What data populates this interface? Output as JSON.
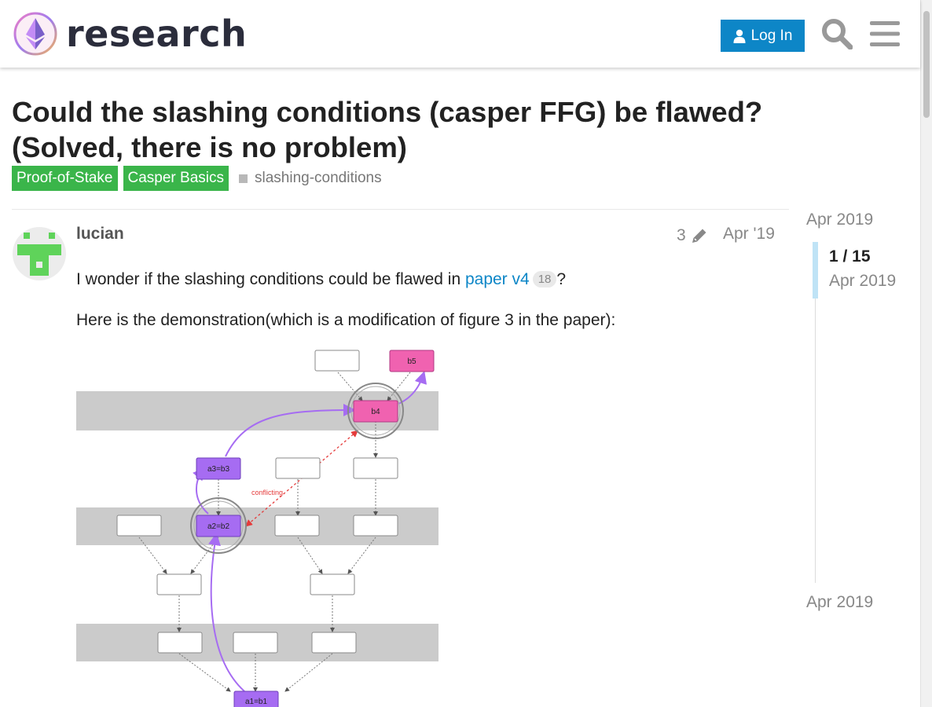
{
  "header": {
    "site_name": "research",
    "login_label": "Log In"
  },
  "topic": {
    "title": "Could the slashing conditions (casper FFG) be flawed? (Solved, there is no problem)",
    "categories": [
      "Proof-of-Stake",
      "Casper Basics"
    ],
    "tag": "slashing-conditions"
  },
  "post": {
    "username": "lucian",
    "edit_count": "3",
    "date": "Apr '19",
    "p1_before": "I wonder if the slashing conditions could be flawed in ",
    "p1_link": "paper v4",
    "p1_clicks": "18",
    "p1_after": "?",
    "p2": "Here is the demonstration(which is a modification of figure 3 in the paper):",
    "figure": {
      "labels": {
        "b5": "b5",
        "b4": "b4",
        "a3b3": "a3=b3",
        "a2b2": "a2=b2",
        "a1b1": "a1=b1",
        "conflicting": "conflicting"
      }
    }
  },
  "timeline": {
    "start": "Apr 2019",
    "position": "1 / 15",
    "position_date": "Apr 2019",
    "end": "Apr 2019"
  },
  "colors": {
    "brand_blue": "#0d86c7",
    "category_green": "#3ab54a",
    "highlight_pink": "#f062b0",
    "highlight_purple": "#a66cf2"
  }
}
